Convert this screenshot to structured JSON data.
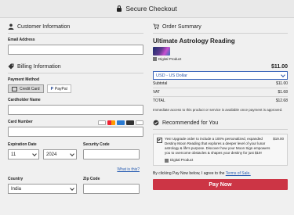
{
  "header": {
    "title": "Secure Checkout",
    "icon": "lock-icon"
  },
  "customer": {
    "title": "Customer Information",
    "email_label": "Email Address",
    "email_value": ""
  },
  "billing": {
    "title": "Billing Information",
    "payment_method_label": "Payment Method",
    "payment_methods": [
      "Credit Card",
      "PayPal"
    ],
    "cardholder_label": "Cardholder Name",
    "card_number_label": "Card Number",
    "card_brands": [
      "visa",
      "mastercard",
      "amex",
      "discover",
      "diners"
    ],
    "expiration_label": "Expiration Date",
    "exp_month": "11",
    "exp_year": "2024",
    "security_code_label": "Security Code",
    "whats_this": "What is this?",
    "country_label": "Country",
    "country_value": "India",
    "zip_label": "Zip Code"
  },
  "summary": {
    "title": "Order Summary",
    "product_title": "Ultimate Astrology Reading",
    "product_type": "Digital Product",
    "price": "$11.00",
    "currency": "USD - US Dollar",
    "lines": [
      {
        "label": "Subtotal",
        "value": "$11.00"
      },
      {
        "label": "VAT",
        "value": "$1.68"
      },
      {
        "label": "TOTAL",
        "value": "$12.68"
      }
    ],
    "access_note": "Immediate access to this product or service is available once payment is approved."
  },
  "recommended": {
    "title": "Recommended for You",
    "text": "Yes! Upgrade order to include a 100% personalized, expanded Destiny Moon Reading that explores a deeper level of your lunar astrology & life's purpose. Discover how your Moon Sign empowers you to overcome obstacles & shapes your destiny for just $19!",
    "price": "$19.00",
    "product_type": "Digital Product"
  },
  "terms": {
    "prefix": "By clicking Pay Now below, I agree to the",
    "link": "Terms of Sale."
  },
  "pay_button": "Pay Now",
  "colors": {
    "pay": "#cc3545",
    "link": "#2b5fb3",
    "currency_border": "#3a64b9"
  }
}
